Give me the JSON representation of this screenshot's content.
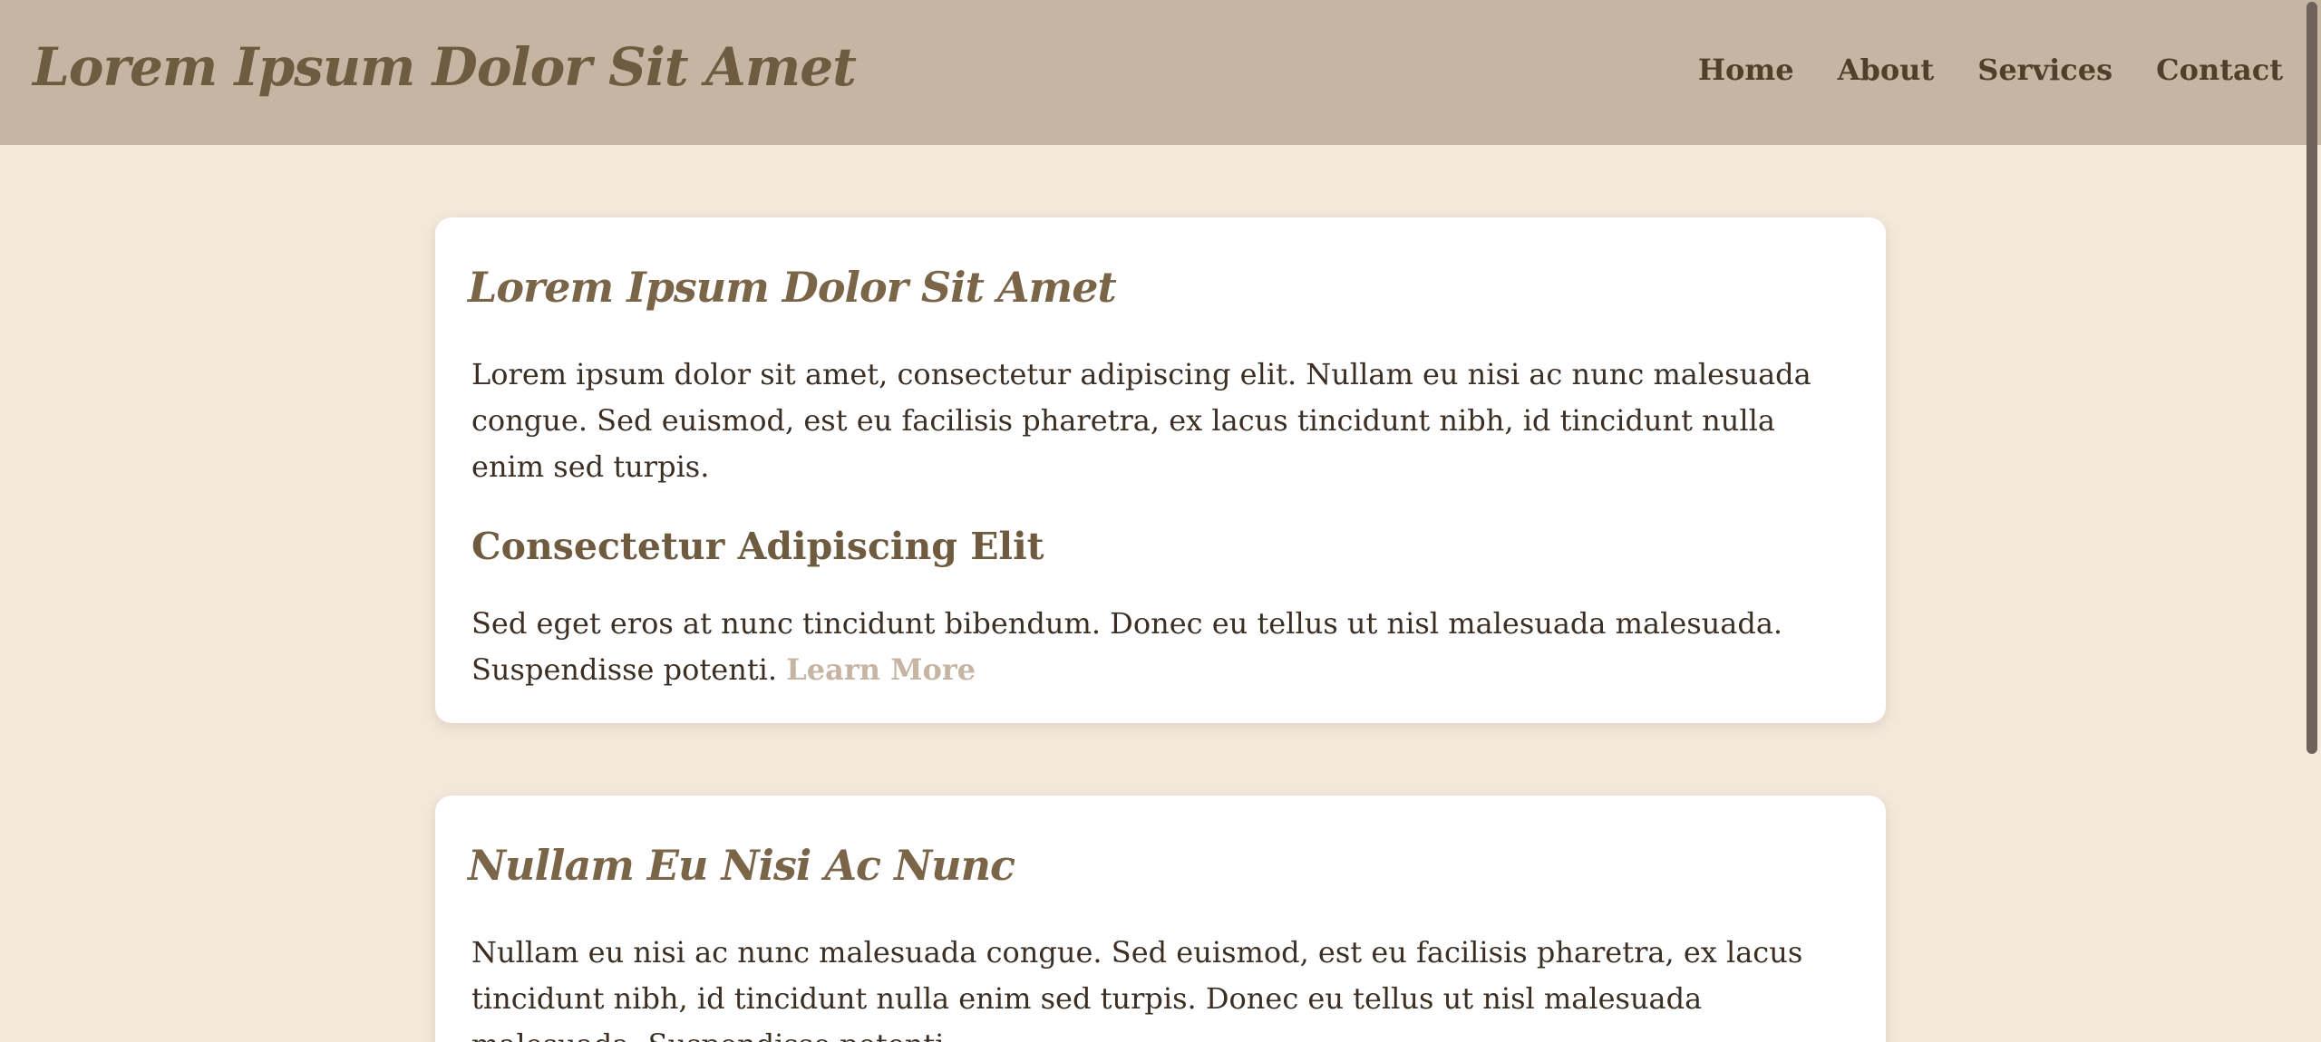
{
  "header": {
    "site_title": "Lorem Ipsum Dolor Sit Amet",
    "nav": [
      {
        "label": "Home"
      },
      {
        "label": "About"
      },
      {
        "label": "Services"
      },
      {
        "label": "Contact"
      }
    ]
  },
  "cards": [
    {
      "title": "Lorem Ipsum Dolor Sit Amet",
      "paragraph_1": "Lorem ipsum dolor sit amet, consectetur adipiscing elit. Nullam eu nisi ac nunc malesuada congue. Sed euismod, est eu facilisis pharetra, ex lacus tincidunt nibh, id tincidunt nulla enim sed turpis.",
      "subheading": "Consectetur Adipiscing Elit",
      "paragraph_2": "Sed eget eros at nunc tincidunt bibendum. Donec eu tellus ut nisl malesuada malesuada. Suspendisse potenti.",
      "link_label": "Learn More"
    },
    {
      "title": "Nullam Eu Nisi Ac Nunc",
      "paragraph_1": "Nullam eu nisi ac nunc malesuada congue. Sed euismod, est eu facilisis pharetra, ex lacus tincidunt nibh, id tincidunt nulla enim sed turpis. Donec eu tellus ut nisl malesuada malesuada. Suspendisse potenti."
    }
  ],
  "colors": {
    "header_bg": "#c5b5a2",
    "page_bg": "#f3e9db",
    "title_brown": "#6f5b40",
    "text_dark": "#3b2f24",
    "link_tan": "#c5b5a2"
  }
}
